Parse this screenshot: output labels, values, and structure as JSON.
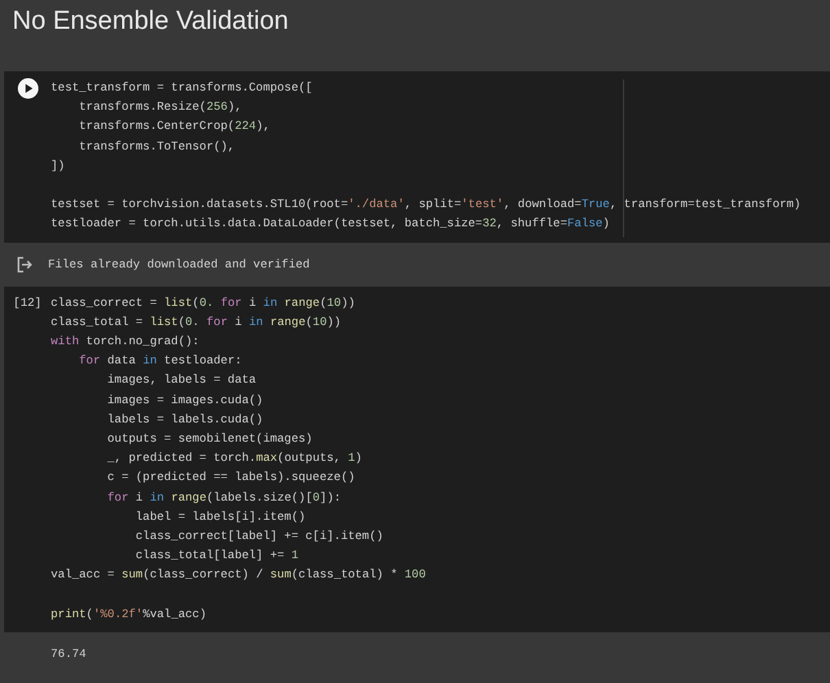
{
  "title": "No Ensemble Validation",
  "cells": [
    {
      "kind": "code",
      "run_button": true,
      "blocks": [
        [
          [
            {
              "text": "test_transform = transforms.Compose([",
              "kind": "plain"
            }
          ],
          [
            {
              "text": "    transforms.Resize(",
              "kind": "plain"
            },
            {
              "text": "256",
              "kind": "number"
            },
            {
              "text": "),",
              "kind": "plain"
            }
          ],
          [
            {
              "text": "    transforms.CenterCrop(",
              "kind": "plain"
            },
            {
              "text": "224",
              "kind": "number"
            },
            {
              "text": "),",
              "kind": "plain"
            }
          ],
          [
            {
              "text": "    transforms.ToTensor(),",
              "kind": "plain"
            }
          ],
          [
            {
              "text": "])",
              "kind": "plain"
            }
          ]
        ],
        [
          [
            {
              "text": "testset = torchvision.datasets.STL10(root=",
              "kind": "plain"
            },
            {
              "text": "'./data'",
              "kind": "string"
            },
            {
              "text": ", split=",
              "kind": "plain"
            },
            {
              "text": "'test'",
              "kind": "string"
            },
            {
              "text": ", download=",
              "kind": "plain"
            },
            {
              "text": "True",
              "kind": "keyword"
            },
            {
              "text": ", transform=test_transform)",
              "kind": "plain"
            }
          ],
          [
            {
              "text": "testloader = torch.utils.data.DataLoader(testset, batch_size=",
              "kind": "plain"
            },
            {
              "text": "32",
              "kind": "number"
            },
            {
              "text": ", shuffle=",
              "kind": "plain"
            },
            {
              "text": "False",
              "kind": "keyword"
            },
            {
              "text": ")",
              "kind": "plain"
            }
          ]
        ]
      ],
      "output": {
        "text": "Files already downloaded and verified",
        "icon": true
      }
    },
    {
      "kind": "code",
      "exec_count": "[12]",
      "blocks": [
        [
          [
            {
              "text": "class_correct = ",
              "kind": "plain"
            },
            {
              "text": "list",
              "kind": "function"
            },
            {
              "text": "(",
              "kind": "plain"
            },
            {
              "text": "0. ",
              "kind": "number"
            },
            {
              "text": "for",
              "kind": "control"
            },
            {
              "text": " i ",
              "kind": "plain"
            },
            {
              "text": "in ",
              "kind": "keyword"
            },
            {
              "text": "range",
              "kind": "function"
            },
            {
              "text": "(",
              "kind": "plain"
            },
            {
              "text": "10",
              "kind": "number"
            },
            {
              "text": "))",
              "kind": "plain"
            }
          ],
          [
            {
              "text": "class_total = ",
              "kind": "plain"
            },
            {
              "text": "list",
              "kind": "function"
            },
            {
              "text": "(",
              "kind": "plain"
            },
            {
              "text": "0. ",
              "kind": "number"
            },
            {
              "text": "for",
              "kind": "control"
            },
            {
              "text": " i ",
              "kind": "plain"
            },
            {
              "text": "in ",
              "kind": "keyword"
            },
            {
              "text": "range",
              "kind": "function"
            },
            {
              "text": "(",
              "kind": "plain"
            },
            {
              "text": "10",
              "kind": "number"
            },
            {
              "text": "))",
              "kind": "plain"
            }
          ],
          [
            {
              "text": "with",
              "kind": "control"
            },
            {
              "text": " torch.no_grad():",
              "kind": "plain"
            }
          ],
          [
            {
              "text": "    for",
              "kind": "control"
            },
            {
              "text": " data ",
              "kind": "plain"
            },
            {
              "text": "in",
              "kind": "keyword"
            },
            {
              "text": " testloader:",
              "kind": "plain"
            }
          ],
          [
            {
              "text": "        images, labels = data",
              "kind": "plain"
            }
          ],
          [
            {
              "text": "        images = images.cuda()",
              "kind": "plain"
            }
          ],
          [
            {
              "text": "        labels = labels.cuda()",
              "kind": "plain"
            }
          ],
          [
            {
              "text": "        outputs = semobilenet(images)",
              "kind": "plain"
            }
          ],
          [
            {
              "text": "        _, predicted = torch.",
              "kind": "plain"
            },
            {
              "text": "max",
              "kind": "function"
            },
            {
              "text": "(outputs, ",
              "kind": "plain"
            },
            {
              "text": "1",
              "kind": "number"
            },
            {
              "text": ")",
              "kind": "plain"
            }
          ],
          [
            {
              "text": "        c = (predicted == labels).squeeze()",
              "kind": "plain"
            }
          ],
          [
            {
              "text": "        for",
              "kind": "control"
            },
            {
              "text": " i ",
              "kind": "plain"
            },
            {
              "text": "in ",
              "kind": "keyword"
            },
            {
              "text": "range",
              "kind": "function"
            },
            {
              "text": "(labels.size()[",
              "kind": "plain"
            },
            {
              "text": "0",
              "kind": "number"
            },
            {
              "text": "]):",
              "kind": "plain"
            }
          ],
          [
            {
              "text": "            label = labels[i].item()",
              "kind": "plain"
            }
          ],
          [
            {
              "text": "            class_correct[label] += c[i].item()",
              "kind": "plain"
            }
          ],
          [
            {
              "text": "            class_total[label] += ",
              "kind": "plain"
            },
            {
              "text": "1",
              "kind": "number"
            }
          ],
          [
            {
              "text": "val_acc = ",
              "kind": "plain"
            },
            {
              "text": "sum",
              "kind": "function"
            },
            {
              "text": "(class_correct) / ",
              "kind": "plain"
            },
            {
              "text": "sum",
              "kind": "function"
            },
            {
              "text": "(class_total) * ",
              "kind": "plain"
            },
            {
              "text": "100",
              "kind": "number"
            }
          ]
        ],
        [
          [
            {
              "text": "print",
              "kind": "function"
            },
            {
              "text": "(",
              "kind": "plain"
            },
            {
              "text": "'%0.2f'",
              "kind": "string"
            },
            {
              "text": "%val_acc)",
              "kind": "plain"
            }
          ]
        ]
      ],
      "output": {
        "text": "76.74",
        "icon": false
      }
    }
  ]
}
